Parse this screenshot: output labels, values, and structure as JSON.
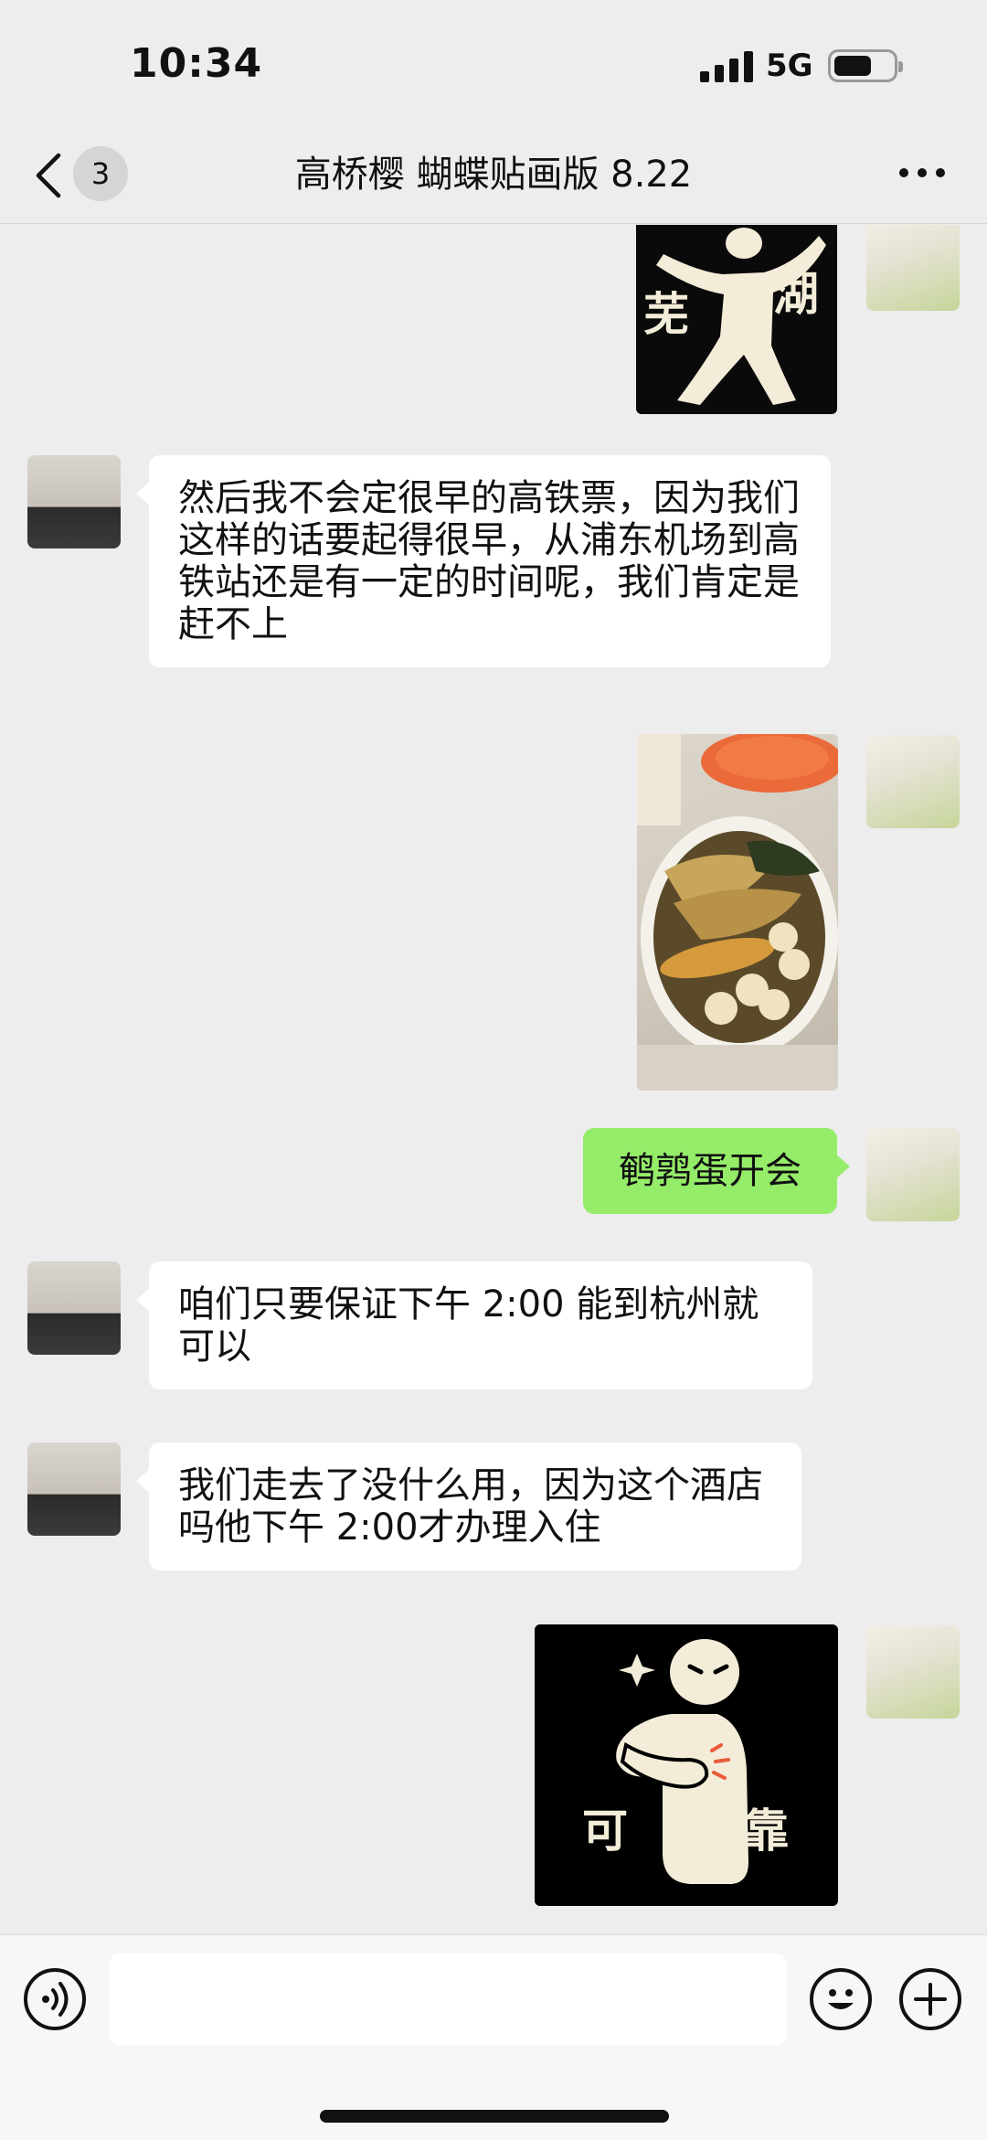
{
  "status_bar": {
    "time": "10:34",
    "network": "5G"
  },
  "header": {
    "unread_count": "3",
    "title": "高桥樱 蝴蝶贴画版 8.22"
  },
  "messages": {
    "m1_sticker": {
      "left_text": "芜",
      "right_text": "湖"
    },
    "m2": {
      "text": "然后我不会定很早的高铁票，因为我们这样的话要起得很早，从浦东机场到高铁站还是有一定的时间呢，我们肯定是赶不上"
    },
    "m4": {
      "text": "鹌鹑蛋开会"
    },
    "m5": {
      "text": "咱们只要保证下午 2:00 能到杭州就可以"
    },
    "m6": {
      "text": "我们走去了没什么用，因为这个酒店吗他下午 2:00才办理入住"
    },
    "m7_sticker": {
      "left_text": "可",
      "right_text": "靠"
    }
  },
  "colors": {
    "background": "#ededed",
    "bubble_out": "#95ec69",
    "bubble_in": "#ffffff"
  },
  "icons": {
    "back": "chevron-left-icon",
    "more": "more-icon",
    "voice": "voice-icon",
    "emoji": "emoji-icon",
    "add": "plus-icon"
  }
}
